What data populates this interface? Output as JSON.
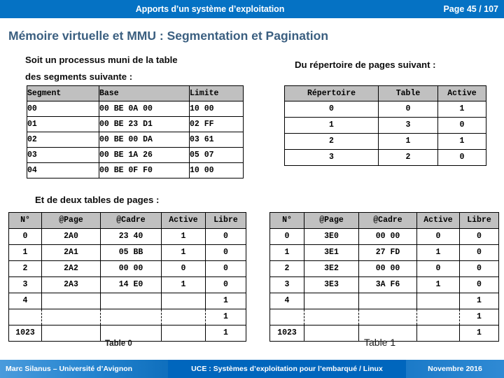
{
  "header": {
    "title": "Apports  d’un système d’exploitation",
    "page_label": "Page 45 / 107",
    "bar_color": "#0572c4"
  },
  "slide": {
    "title": "Mémoire virtuelle et MMU : Segmentation et Pagination",
    "title_color": "#3b5f80"
  },
  "intro": {
    "left_line1": "Soit un processus muni de la table",
    "left_line2": "des segments suivante :",
    "right": "Du répertoire de pages suivant :",
    "pages_caption": "Et de deux tables de pages :"
  },
  "segments_table": {
    "headers": [
      "Segment",
      "Base",
      "Limite"
    ],
    "rows": [
      [
        "00",
        "00 BE 0A 00",
        "10 00"
      ],
      [
        "01",
        "00 BE 23 D1",
        "02 FF"
      ],
      [
        "02",
        "00 BE 00 DA",
        "03 61"
      ],
      [
        "03",
        "00 BE 1A 26",
        "05 07"
      ],
      [
        "04",
        "00 BE 0F F0",
        "10 00"
      ]
    ]
  },
  "directory_table": {
    "headers": [
      "Répertoire",
      "Table",
      "Active"
    ],
    "rows": [
      [
        "0",
        "0",
        "1"
      ],
      [
        "1",
        "3",
        "0"
      ],
      [
        "2",
        "1",
        "1"
      ],
      [
        "3",
        "2",
        "0"
      ]
    ]
  },
  "page_table_0": {
    "caption": "Table 0",
    "headers": [
      "N°",
      "@Page",
      "@Cadre",
      "Active",
      "Libre"
    ],
    "rows": [
      [
        "0",
        "2A0",
        "23 40",
        "1",
        "0"
      ],
      [
        "1",
        "2A1",
        "05 BB",
        "1",
        "0"
      ],
      [
        "2",
        "2A2",
        "00 00",
        "0",
        "0"
      ],
      [
        "3",
        "2A3",
        "14 E0",
        "1",
        "0"
      ],
      [
        "4",
        "",
        "",
        "",
        "1"
      ],
      [
        "",
        "",
        "",
        "",
        "1"
      ],
      [
        "1023",
        "",
        "",
        "",
        "1"
      ]
    ]
  },
  "page_table_1": {
    "caption": "Table 1",
    "headers": [
      "N°",
      "@Page",
      "@Cadre",
      "Active",
      "Libre"
    ],
    "rows": [
      [
        "0",
        "3E0",
        "00 00",
        "0",
        "0"
      ],
      [
        "1",
        "3E1",
        "27 FD",
        "1",
        "0"
      ],
      [
        "2",
        "3E2",
        "00 00",
        "0",
        "0"
      ],
      [
        "3",
        "3E3",
        "3A F6",
        "1",
        "0"
      ],
      [
        "4",
        "",
        "",
        "",
        "1"
      ],
      [
        "",
        "",
        "",
        "",
        "1"
      ],
      [
        "1023",
        "",
        "",
        "",
        "1"
      ]
    ]
  },
  "footer": {
    "left": "Marc Silanus – Université d’Avignon",
    "center": "UCE : Systèmes d’exploitation pour l’embarqué / Linux",
    "right": "Novembre 2016",
    "center_color": "#0066bd"
  }
}
